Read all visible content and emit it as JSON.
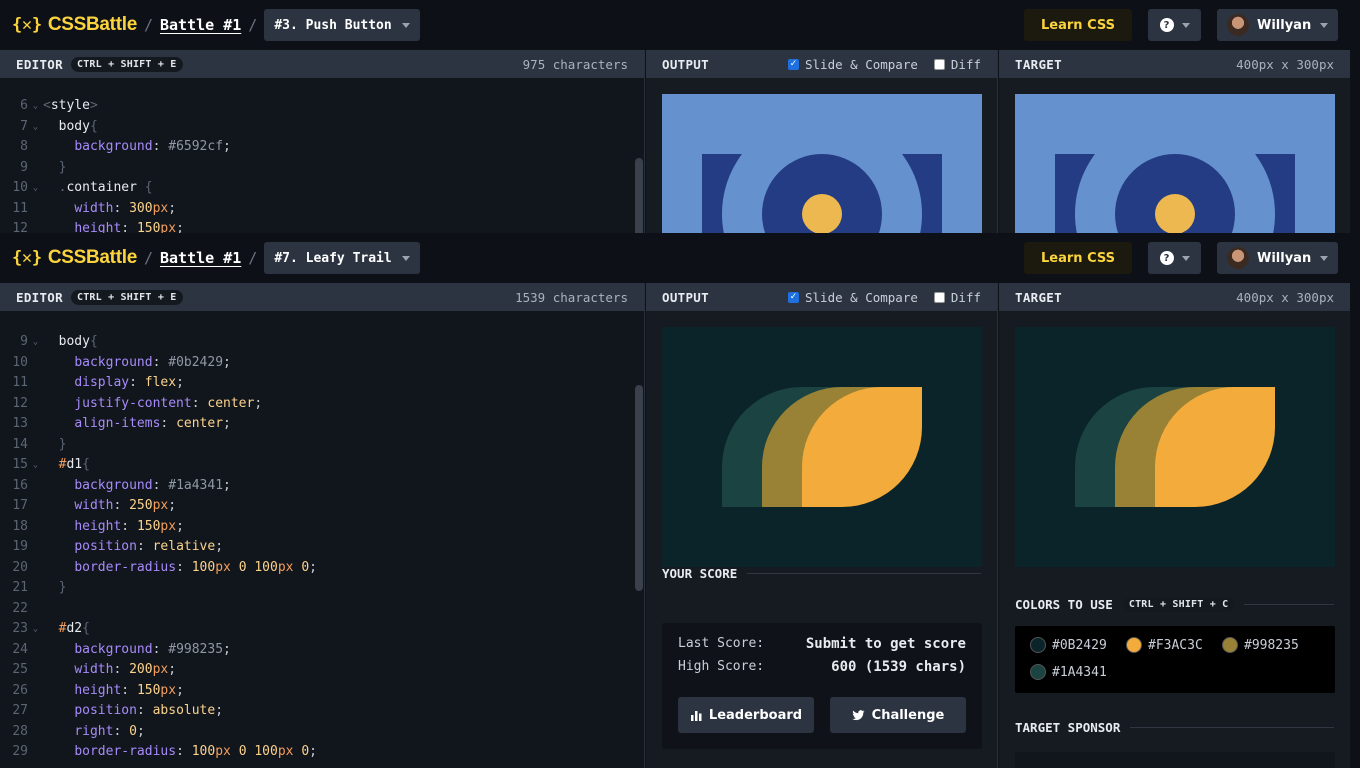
{
  "app": {
    "logo_mark": "{✕}",
    "logo_text": "CSSBattle",
    "separator": "/",
    "battle_link": "Battle #1",
    "learn_label": "Learn CSS",
    "help_glyph": "?",
    "user_name": "Willyan"
  },
  "labels": {
    "editor": "EDITOR",
    "editor_shortcut": "CTRL + SHIFT + E",
    "output": "OUTPUT",
    "slide_compare": "Slide & Compare",
    "diff": "Diff",
    "target": "TARGET",
    "target_size": "400px x 300px"
  },
  "top_pane": {
    "target_name": "#3. Push Button",
    "char_count": "975 characters",
    "slide_compare_checked": true,
    "diff_checked": false,
    "code_lines": [
      {
        "n": "6",
        "fold": true,
        "html": "<span class=\"tok-br\">&lt;</span><span class=\"tok-tag\">style</span><span class=\"tok-br\">&gt;</span>"
      },
      {
        "n": "7",
        "fold": true,
        "html": "  <span class=\"tok-sel\">body</span><span class=\"tok-br\">{</span>"
      },
      {
        "n": "8",
        "fold": false,
        "html": "    <span class=\"tok-prop\">background</span><span class=\"tok-punc\">: </span><span class=\"tok-color\">#6592cf</span><span class=\"tok-punc\">;</span>"
      },
      {
        "n": "9",
        "fold": false,
        "html": "  <span class=\"tok-br\">}</span>"
      },
      {
        "n": "10",
        "fold": true,
        "html": "  <span class=\"tok-br\">.</span><span class=\"tok-sel\">container</span> <span class=\"tok-br\">{</span>"
      },
      {
        "n": "11",
        "fold": false,
        "html": "    <span class=\"tok-prop\">width</span><span class=\"tok-punc\">: </span><span class=\"tok-val\">300</span><span class=\"tok-unit\">px</span><span class=\"tok-punc\">;</span>"
      },
      {
        "n": "12",
        "fold": false,
        "html": "    <span class=\"tok-prop\">height</span><span class=\"tok-punc\">: </span><span class=\"tok-val\">150</span><span class=\"tok-unit\">px</span><span class=\"tok-punc\">;</span>"
      }
    ],
    "colors": {
      "bg": "#6592cf",
      "dark": "#243c84",
      "yellow": "#eeb850"
    }
  },
  "bottom_pane": {
    "target_name": "#7. Leafy Trail",
    "char_count": "1539 characters",
    "slide_compare_checked": true,
    "diff_checked": false,
    "code_lines": [
      {
        "n": "9",
        "fold": true,
        "html": "  <span class=\"tok-sel\">body</span><span class=\"tok-br\">{</span>"
      },
      {
        "n": "10",
        "fold": false,
        "html": "    <span class=\"tok-prop\">background</span><span class=\"tok-punc\">: </span><span class=\"tok-color\">#0b2429</span><span class=\"tok-punc\">;</span>"
      },
      {
        "n": "11",
        "fold": false,
        "html": "    <span class=\"tok-prop\">display</span><span class=\"tok-punc\">: </span><span class=\"tok-val\">flex</span><span class=\"tok-punc\">;</span>"
      },
      {
        "n": "12",
        "fold": false,
        "html": "    <span class=\"tok-prop\">justify-content</span><span class=\"tok-punc\">: </span><span class=\"tok-val\">center</span><span class=\"tok-punc\">;</span>"
      },
      {
        "n": "13",
        "fold": false,
        "html": "    <span class=\"tok-prop\">align-items</span><span class=\"tok-punc\">: </span><span class=\"tok-val\">center</span><span class=\"tok-punc\">;</span>"
      },
      {
        "n": "14",
        "fold": false,
        "html": "  <span class=\"tok-br\">}</span>"
      },
      {
        "n": "15",
        "fold": true,
        "html": "  <span class=\"tok-hash\">#</span><span class=\"tok-id\">d1</span><span class=\"tok-br\">{</span>"
      },
      {
        "n": "16",
        "fold": false,
        "html": "    <span class=\"tok-prop\">background</span><span class=\"tok-punc\">: </span><span class=\"tok-color\">#1a4341</span><span class=\"tok-punc\">;</span>"
      },
      {
        "n": "17",
        "fold": false,
        "html": "    <span class=\"tok-prop\">width</span><span class=\"tok-punc\">: </span><span class=\"tok-val\">250</span><span class=\"tok-unit\">px</span><span class=\"tok-punc\">;</span>"
      },
      {
        "n": "18",
        "fold": false,
        "html": "    <span class=\"tok-prop\">height</span><span class=\"tok-punc\">: </span><span class=\"tok-val\">150</span><span class=\"tok-unit\">px</span><span class=\"tok-punc\">;</span>"
      },
      {
        "n": "19",
        "fold": false,
        "html": "    <span class=\"tok-prop\">position</span><span class=\"tok-punc\">: </span><span class=\"tok-val\">relative</span><span class=\"tok-punc\">;</span>"
      },
      {
        "n": "20",
        "fold": false,
        "html": "    <span class=\"tok-prop\">border-radius</span><span class=\"tok-punc\">: </span><span class=\"tok-val\">100</span><span class=\"tok-unit\">px</span> <span class=\"tok-val\">0</span> <span class=\"tok-val\">100</span><span class=\"tok-unit\">px</span> <span class=\"tok-val\">0</span><span class=\"tok-punc\">;</span>"
      },
      {
        "n": "21",
        "fold": false,
        "html": "  <span class=\"tok-br\">}</span>"
      },
      {
        "n": "22",
        "fold": false,
        "html": ""
      },
      {
        "n": "23",
        "fold": true,
        "html": "  <span class=\"tok-hash\">#</span><span class=\"tok-id\">d2</span><span class=\"tok-br\">{</span>"
      },
      {
        "n": "24",
        "fold": false,
        "html": "    <span class=\"tok-prop\">background</span><span class=\"tok-punc\">: </span><span class=\"tok-color\">#998235</span><span class=\"tok-punc\">;</span>"
      },
      {
        "n": "25",
        "fold": false,
        "html": "    <span class=\"tok-prop\">width</span><span class=\"tok-punc\">: </span><span class=\"tok-val\">200</span><span class=\"tok-unit\">px</span><span class=\"tok-punc\">;</span>"
      },
      {
        "n": "26",
        "fold": false,
        "html": "    <span class=\"tok-prop\">height</span><span class=\"tok-punc\">: </span><span class=\"tok-val\">150</span><span class=\"tok-unit\">px</span><span class=\"tok-punc\">;</span>"
      },
      {
        "n": "27",
        "fold": false,
        "html": "    <span class=\"tok-prop\">position</span><span class=\"tok-punc\">: </span><span class=\"tok-val\">absolute</span><span class=\"tok-punc\">;</span>"
      },
      {
        "n": "28",
        "fold": false,
        "html": "    <span class=\"tok-prop\">right</span><span class=\"tok-punc\">: </span><span class=\"tok-val\">0</span><span class=\"tok-punc\">;</span>"
      },
      {
        "n": "29",
        "fold": false,
        "html": "    <span class=\"tok-prop\">border-radius</span><span class=\"tok-punc\">: </span><span class=\"tok-val\">100</span><span class=\"tok-unit\">px</span> <span class=\"tok-val\">0</span> <span class=\"tok-val\">100</span><span class=\"tok-unit\">px</span> <span class=\"tok-val\">0</span><span class=\"tok-punc\">;</span>"
      }
    ],
    "score": {
      "title": "YOUR SCORE",
      "last_label": "Last Score:",
      "last_value": "Submit to get score",
      "high_label": "High Score:",
      "high_value": "600 (1539 chars)",
      "leaderboard_label": "Leaderboard",
      "challenge_label": "Challenge"
    },
    "colors_title": "COLORS TO USE",
    "colors_shortcut": "CTRL + SHIFT + C",
    "palette": [
      "#0B2429",
      "#F3AC3C",
      "#998235",
      "#1A4341"
    ],
    "sponsor_title": "TARGET SPONSOR"
  }
}
